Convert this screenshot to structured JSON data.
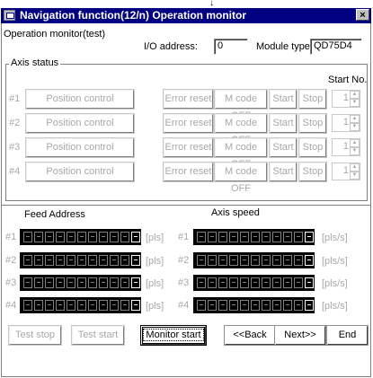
{
  "window": {
    "title": "Navigation function(12/n) Operation monitor",
    "close_glyph": "×",
    "top_arrow_glyph": "↓"
  },
  "header": {
    "test_label": "Operation monitor(test)",
    "io_label": "I/O address:",
    "io_value": "0",
    "module_label": "Module type:",
    "module_value": "QD75D4"
  },
  "axis_status": {
    "title": "Axis status",
    "start_no_label": "Start No.",
    "rows": [
      {
        "no": "#1",
        "mode": "Position control",
        "error_reset": "Error reset",
        "mcode_off": "M code OFF",
        "start": "Start",
        "stop": "Stop",
        "start_no": "1"
      },
      {
        "no": "#2",
        "mode": "Position control",
        "error_reset": "Error reset",
        "mcode_off": "M code OFF",
        "start": "Start",
        "stop": "Stop",
        "start_no": "1"
      },
      {
        "no": "#3",
        "mode": "Position control",
        "error_reset": "Error reset",
        "mcode_off": "M code OFF",
        "start": "Start",
        "stop": "Stop",
        "start_no": "1"
      },
      {
        "no": "#4",
        "mode": "Position control",
        "error_reset": "Error reset",
        "mcode_off": "M code OFF",
        "start": "Start",
        "stop": "Stop",
        "start_no": "1"
      }
    ]
  },
  "monitor": {
    "feed_title": "Feed Address",
    "speed_title": "Axis speed",
    "feed_unit": "[pls]",
    "speed_unit": "[pls/s]",
    "rows": [
      "#1",
      "#2",
      "#3",
      "#4"
    ]
  },
  "footer": {
    "test_stop": "Test stop",
    "test_start": "Test start",
    "monitor_start": "Monitor start",
    "back": "<<Back",
    "next": "Next>>",
    "end": "End"
  }
}
